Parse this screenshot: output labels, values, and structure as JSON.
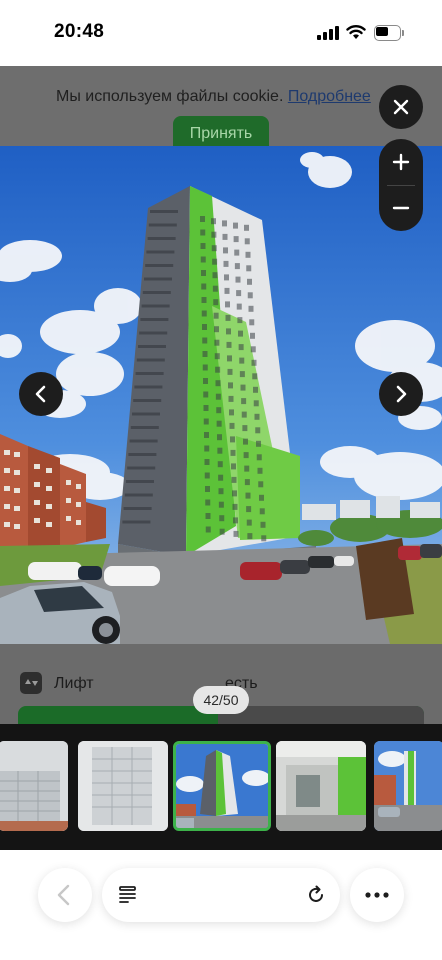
{
  "status": {
    "time": "20:48",
    "battery_level": 0.55
  },
  "cookie": {
    "text": "Мы используем файлы cookie.",
    "link": "Подробнее",
    "accept_label": "Принять"
  },
  "details": {
    "lift_label": "Лифт",
    "lift_value": "есть"
  },
  "gallery": {
    "counter": "42/50",
    "current_index": 42,
    "total": 50,
    "icons": {
      "close": "close-icon",
      "zoom_in": "plus-icon",
      "zoom_out": "minus-icon",
      "prev": "chevron-left-icon",
      "next": "chevron-right-icon"
    },
    "thumbnails": [
      {
        "name": "thumb-mailboxes-1",
        "active": false
      },
      {
        "name": "thumb-mailboxes-2",
        "active": false
      },
      {
        "name": "thumb-building",
        "active": true
      },
      {
        "name": "thumb-entrance",
        "active": false
      },
      {
        "name": "thumb-street",
        "active": false
      }
    ]
  },
  "toolbar": {
    "icons": [
      "chevron-left-icon",
      "tabs-icon",
      "reload-icon",
      "more-icon"
    ]
  },
  "colors": {
    "accent_green": "#1f6b2a",
    "active_thumb_border": "#3db24a",
    "overlay_button": "#1d1d1d"
  }
}
